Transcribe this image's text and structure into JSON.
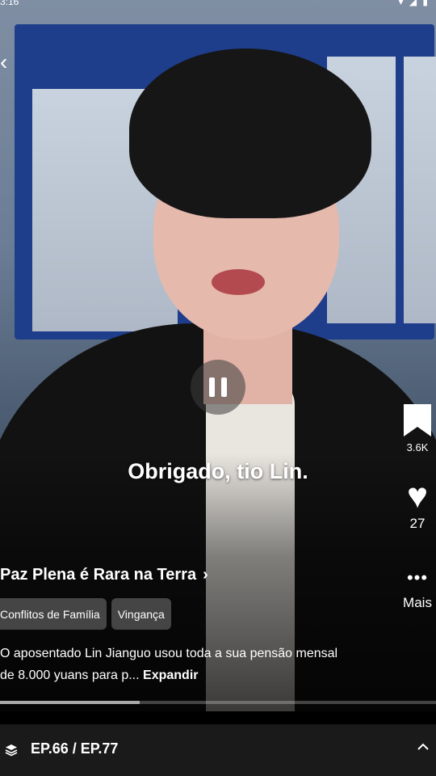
{
  "status_bar": {
    "time": "3:16",
    "icons": "▾ ◢ ▮"
  },
  "back_icon": "‹",
  "video": {
    "subtitle": "Obrigado, tio Lin.",
    "progress": 0.32
  },
  "actions": {
    "bookmark_count": "3.6K",
    "like_count": "27",
    "more_label": "Mais"
  },
  "show": {
    "title": "Paz Plena é Rara na Terra",
    "title_chevron": "›",
    "tags": [
      "Conflitos de Família",
      "Vingança"
    ],
    "description": "O aposentado Lin Jianguo usou toda a sua pensão mensal de 8.000 yuans para p...",
    "expand_label": "Expandir"
  },
  "episode_bar": {
    "label": "EP.66 / EP.77"
  },
  "icons": {
    "back": "back-icon",
    "pause": "pause-icon",
    "bookmark": "bookmark-icon",
    "like": "heart-icon",
    "more": "more-dots-icon",
    "episodes": "layers-icon",
    "expand_episodes": "chevron-up-icon"
  }
}
